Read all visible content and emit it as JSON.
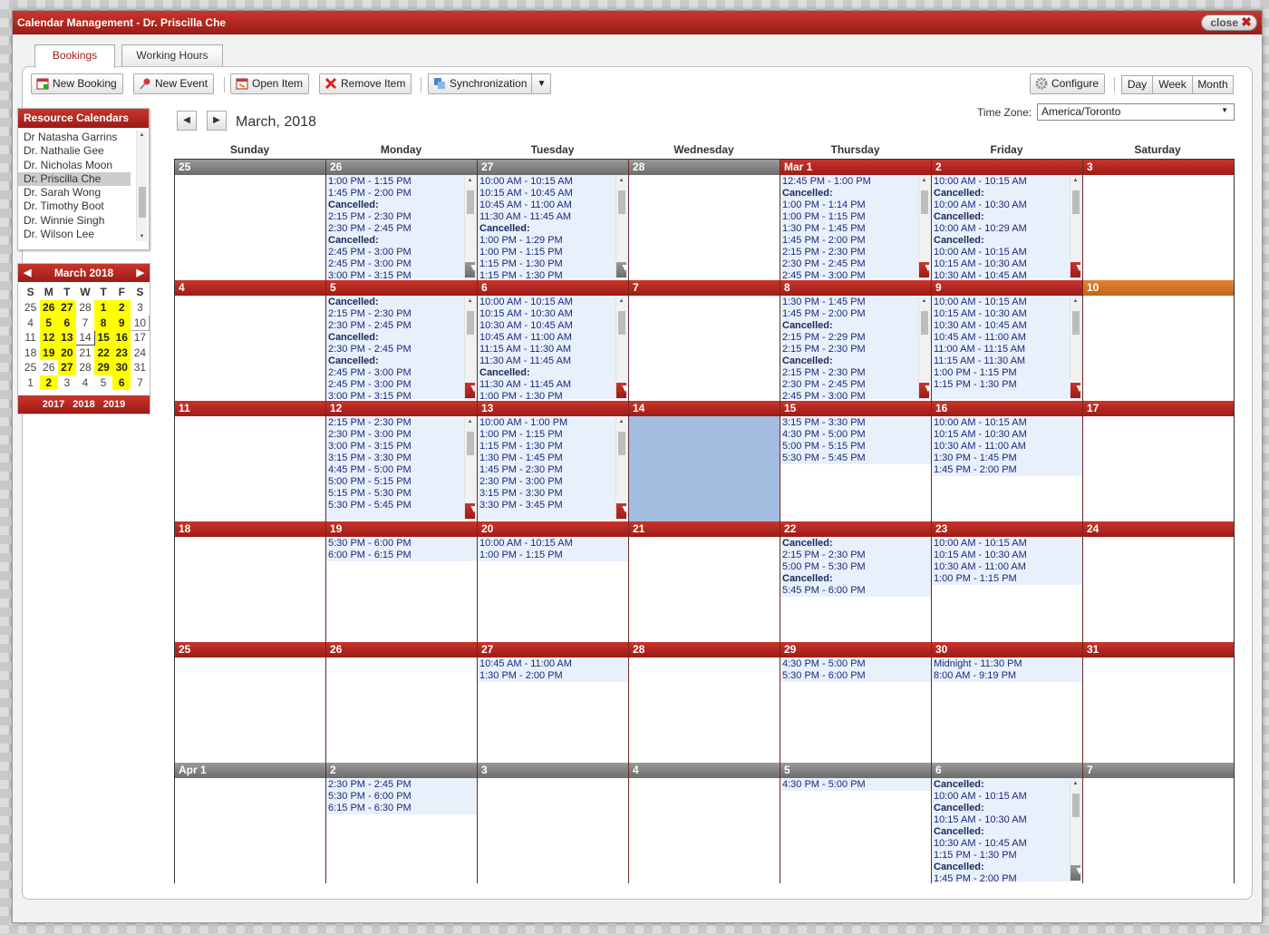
{
  "window": {
    "title": "Calendar Management - Dr. Priscilla Che",
    "close_label": "close"
  },
  "tabs": [
    {
      "label": "Bookings"
    },
    {
      "label": "Working Hours"
    }
  ],
  "toolbar": {
    "new_booking": "New Booking",
    "new_event": "New Event",
    "open_item": "Open Item",
    "remove_item": "Remove Item",
    "sync": "Synchronization",
    "configure": "Configure",
    "views": [
      "Day",
      "Week",
      "Month"
    ]
  },
  "resources": {
    "title": "Resource Calendars",
    "items": [
      "Dr Natasha Garrins",
      "Dr. Nathalie Gee",
      "Dr. Nicholas Moon",
      "Dr. Priscilla Che",
      "Dr. Sarah Wong",
      "Dr. Timothy Boot",
      "Dr. Winnie Singh",
      "Dr. Wilson Lee"
    ],
    "selected": "Dr. Priscilla Che"
  },
  "mini_calendar": {
    "title": "March 2018",
    "weekdays": [
      "S",
      "M",
      "T",
      "W",
      "T",
      "F",
      "S"
    ],
    "weeks": [
      [
        "25",
        "26",
        "27",
        "28",
        "1",
        "2",
        "3"
      ],
      [
        "4",
        "5",
        "6",
        "7",
        "8",
        "9",
        "10"
      ],
      [
        "11",
        "12",
        "13",
        "14",
        "15",
        "16",
        "17"
      ],
      [
        "18",
        "19",
        "20",
        "21",
        "22",
        "23",
        "24"
      ],
      [
        "25",
        "26",
        "27",
        "28",
        "29",
        "30",
        "31"
      ],
      [
        "1",
        "2",
        "3",
        "4",
        "5",
        "6",
        "7"
      ]
    ],
    "years": "2017 2018 2019"
  },
  "header": {
    "month_title": "March, 2018",
    "timezone_label": "Time Zone:",
    "timezone": "America/Toronto"
  },
  "weekdays": [
    "Sunday",
    "Monday",
    "Tuesday",
    "Wednesday",
    "Thursday",
    "Friday",
    "Saturday"
  ],
  "weeks": [
    [
      {
        "label": "25",
        "events": []
      },
      {
        "label": "26",
        "events": [
          "1:00 PM - 1:15 PM",
          "1:45 PM - 2:00 PM",
          "Cancelled:",
          "2:15 PM - 2:30 PM",
          "2:30 PM - 2:45 PM",
          "Cancelled:",
          "2:45 PM - 3:00 PM",
          "2:45 PM - 3:00 PM",
          "3:00 PM - 3:15 PM"
        ]
      },
      {
        "label": "27",
        "events": [
          "10:00 AM - 10:15 AM",
          "10:15 AM - 10:45 AM",
          "10:45 AM - 11:00 AM",
          "11:30 AM - 11:45 AM",
          "Cancelled:",
          "1:00 PM - 1:29 PM",
          "1:00 PM - 1:15 PM",
          "1:15 PM - 1:30 PM",
          "1:15 PM - 1:30 PM"
        ]
      },
      {
        "label": "28",
        "events": []
      },
      {
        "label": "Mar 1",
        "events": [
          "12:45 PM - 1:00 PM",
          "Cancelled:",
          "1:00 PM - 1:14 PM",
          "1:00 PM - 1:15 PM",
          "1:30 PM - 1:45 PM",
          "1:45 PM - 2:00 PM",
          "2:15 PM - 2:30 PM",
          "2:30 PM - 2:45 PM",
          "2:45 PM - 3:00 PM"
        ]
      },
      {
        "label": "2",
        "events": [
          "10:00 AM - 10:15 AM",
          "Cancelled:",
          "10:00 AM - 10:30 AM",
          "Cancelled:",
          "10:00 AM - 10:29 AM",
          "Cancelled:",
          "10:00 AM - 10:15 AM",
          "10:15 AM - 10:30 AM",
          "10:30 AM - 10:45 AM"
        ]
      },
      {
        "label": "3",
        "events": []
      }
    ],
    [
      {
        "label": "4",
        "events": []
      },
      {
        "label": "5",
        "events": [
          "Cancelled:",
          "2:15 PM - 2:30 PM",
          "2:30 PM - 2:45 PM",
          "Cancelled:",
          "2:30 PM - 2:45 PM",
          "Cancelled:",
          "2:45 PM - 3:00 PM",
          "2:45 PM - 3:00 PM",
          "3:00 PM - 3:15 PM"
        ]
      },
      {
        "label": "6",
        "events": [
          "10:00 AM - 10:15 AM",
          "10:15 AM - 10:30 AM",
          "10:30 AM - 10:45 AM",
          "10:45 AM - 11:00 AM",
          "11:15 AM - 11:30 AM",
          "11:30 AM - 11:45 AM",
          "Cancelled:",
          "11:30 AM - 11:45 AM",
          "1:00 PM - 1:30 PM"
        ]
      },
      {
        "label": "7",
        "events": []
      },
      {
        "label": "8",
        "events": [
          "1:30 PM - 1:45 PM",
          "1:45 PM - 2:00 PM",
          "Cancelled:",
          "2:15 PM - 2:29 PM",
          "2:15 PM - 2:30 PM",
          "Cancelled:",
          "2:15 PM - 2:30 PM",
          "2:30 PM - 2:45 PM",
          "2:45 PM - 3:00 PM"
        ]
      },
      {
        "label": "9",
        "events": [
          "10:00 AM - 10:15 AM",
          "10:15 AM - 10:30 AM",
          "10:30 AM - 10:45 AM",
          "10:45 AM - 11:00 AM",
          "11:00 AM - 11:15 AM",
          "11:15 AM - 11:30 AM",
          "1:00 PM - 1:15 PM",
          "1:15 PM - 1:30 PM"
        ]
      },
      {
        "label": "10",
        "events": []
      }
    ],
    [
      {
        "label": "11",
        "events": []
      },
      {
        "label": "12",
        "events": [
          "2:15 PM - 2:30 PM",
          "2:30 PM - 3:00 PM",
          "3:00 PM - 3:15 PM",
          "3:15 PM - 3:30 PM",
          "4:45 PM - 5:00 PM",
          "5:00 PM - 5:15 PM",
          "5:15 PM - 5:30 PM",
          "5:30 PM - 5:45 PM"
        ]
      },
      {
        "label": "13",
        "events": [
          "10:00 AM - 1:00 PM",
          "1:00 PM - 1:15 PM",
          "1:15 PM - 1:30 PM",
          "1:30 PM - 1:45 PM",
          "1:45 PM - 2:30 PM",
          "2:30 PM - 3:00 PM",
          "3:15 PM - 3:30 PM",
          "3:30 PM - 3:45 PM"
        ]
      },
      {
        "label": "14",
        "events": []
      },
      {
        "label": "15",
        "events": [
          "3:15 PM - 3:30 PM",
          "4:30 PM - 5:00 PM",
          "5:00 PM - 5:15 PM",
          "5:30 PM - 5:45 PM"
        ]
      },
      {
        "label": "16",
        "events": [
          "10:00 AM - 10:15 AM",
          "10:15 AM - 10:30 AM",
          "10:30 AM - 11:00 AM",
          "1:30 PM - 1:45 PM",
          "1:45 PM - 2:00 PM"
        ]
      },
      {
        "label": "17",
        "events": []
      }
    ],
    [
      {
        "label": "18",
        "events": []
      },
      {
        "label": "19",
        "events": [
          "5:30 PM - 6:00 PM",
          "6:00 PM - 6:15 PM"
        ]
      },
      {
        "label": "20",
        "events": [
          "10:00 AM - 10:15 AM",
          "1:00 PM - 1:15 PM"
        ]
      },
      {
        "label": "21",
        "events": []
      },
      {
        "label": "22",
        "events": [
          "Cancelled:",
          "2:15 PM - 2:30 PM",
          "5:00 PM - 5:30 PM",
          "Cancelled:",
          "5:45 PM - 6:00 PM"
        ]
      },
      {
        "label": "23",
        "events": [
          "10:00 AM - 10:15 AM",
          "10:15 AM - 10:30 AM",
          "10:30 AM - 11:00 AM",
          "1:00 PM - 1:15 PM"
        ]
      },
      {
        "label": "24",
        "events": []
      }
    ],
    [
      {
        "label": "25",
        "events": []
      },
      {
        "label": "26",
        "events": []
      },
      {
        "label": "27",
        "events": [
          "10:45 AM - 11:00 AM",
          "1:30 PM - 2:00 PM"
        ]
      },
      {
        "label": "28",
        "events": []
      },
      {
        "label": "29",
        "events": [
          "4:30 PM - 5:00 PM",
          "5:30 PM - 6:00 PM"
        ]
      },
      {
        "label": "30",
        "events": [
          "Midnight - 11:30 PM",
          "8:00 AM - 9:19 PM"
        ]
      },
      {
        "label": "31",
        "events": []
      }
    ],
    [
      {
        "label": "Apr 1",
        "events": []
      },
      {
        "label": "2",
        "events": [
          "2:30 PM - 2:45 PM",
          "5:30 PM - 6:00 PM",
          "6:15 PM - 6:30 PM"
        ]
      },
      {
        "label": "3",
        "events": []
      },
      {
        "label": "4",
        "events": []
      },
      {
        "label": "5",
        "events": [
          "4:30 PM - 5:00 PM"
        ]
      },
      {
        "label": "6",
        "events": [
          "Cancelled:",
          "10:00 AM - 10:15 AM",
          "Cancelled:",
          "10:15 AM - 10:30 AM",
          "Cancelled:",
          "10:30 AM - 10:45 AM",
          "1:15 PM - 1:30 PM",
          "Cancelled:",
          "1:45 PM - 2:00 PM"
        ]
      },
      {
        "label": "7",
        "events": []
      }
    ]
  ]
}
